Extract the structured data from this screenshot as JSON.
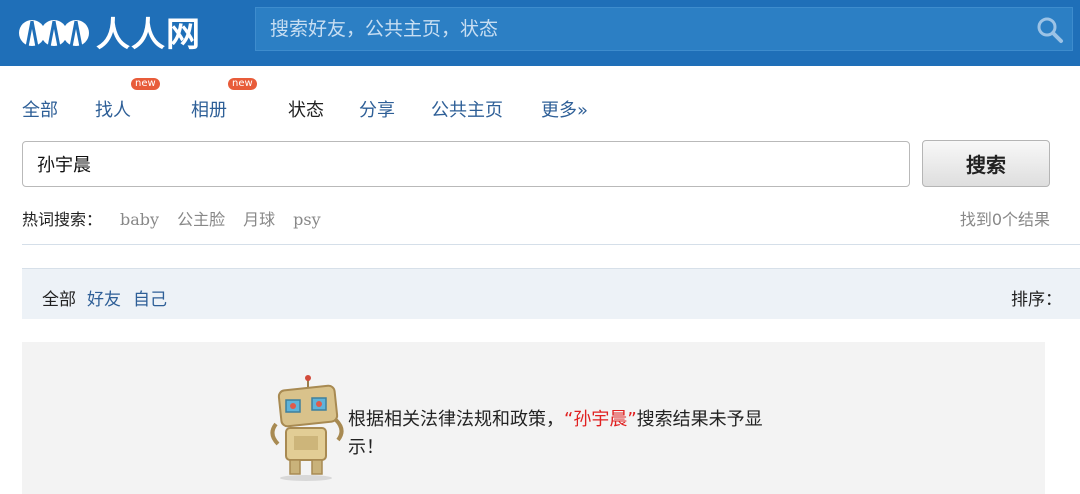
{
  "header": {
    "logo_text": "人人网",
    "search_placeholder": "搜索好友，公共主页，状态"
  },
  "tabs": [
    {
      "label": "全部"
    },
    {
      "label": "找人",
      "badge": "new"
    },
    {
      "label": "相册",
      "badge": "new"
    },
    {
      "label": "状态"
    },
    {
      "label": "分享"
    },
    {
      "label": "公共主页"
    },
    {
      "label": "更多»"
    }
  ],
  "search": {
    "query": "孙宇晨",
    "button_label": "搜索"
  },
  "hot": {
    "label": "热词搜索：",
    "items": [
      "baby",
      "公主脸",
      "月球",
      "psy"
    ]
  },
  "result_count": "找到0个结果",
  "filters": {
    "items": [
      "全部",
      "好友",
      "自己"
    ],
    "sort_label": "排序："
  },
  "notice": {
    "prefix": "根据相关法律法规和政策，",
    "term": "“孙宇晨”",
    "suffix": "搜索结果未予显示！"
  },
  "colors": {
    "header_bg": "#1f6fb8",
    "link": "#2e5f97",
    "highlight": "#e02020"
  }
}
